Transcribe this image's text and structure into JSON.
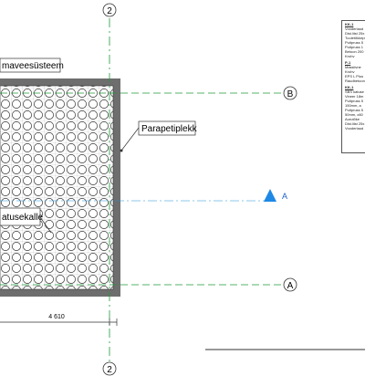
{
  "grid_axes": {
    "vertical_top": "2",
    "vertical_bottom": "2",
    "horizontal_b": "B",
    "horizontal_a": "A"
  },
  "labels": {
    "drainage_system": "maveesüsteem",
    "parapet": "Parapetiplekk",
    "slope": "atusekalle",
    "section_marker": "A",
    "dimension": "4 610"
  },
  "legend": {
    "sections": [
      {
        "title": "KK-1",
        "lines": [
          "Vooderlaud",
          "Dist.liist 25x",
          "Tuuletõkkeplaat",
          "Puitpruss 5",
          "Puitpruss 1",
          "Betoon 200",
          "Krohv"
        ]
      },
      {
        "title": "P-1",
        "lines": [
          "Massiivne",
          "Krohv",
          "EPS L Plus",
          "Raudbetoon"
        ]
      },
      {
        "title": "KK-1",
        "lines": [
          "SBS katuse",
          "Vineer 18m",
          "Puitpruss 5",
          "150mm, a",
          "Puitpruss 5",
          "50mm, c60",
          "Aurutõke",
          "Dist.liist 25x",
          "Vooderlaud"
        ]
      }
    ]
  },
  "colors": {
    "grid_line": "#1f9a3a",
    "section_line": "#1b8fd6",
    "section_marker": "#1e88e5",
    "wall": "#6e6e6e"
  }
}
